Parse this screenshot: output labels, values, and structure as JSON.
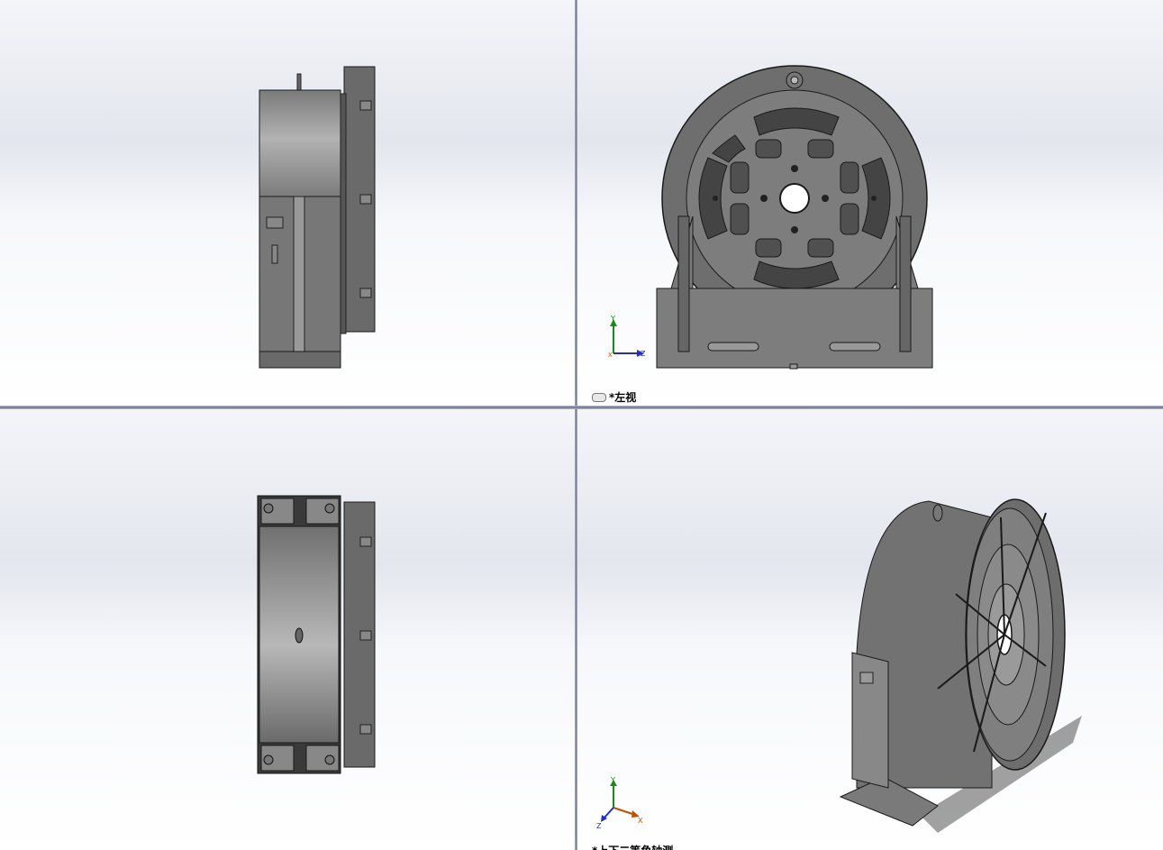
{
  "viewports": {
    "top_right": {
      "label": "*左视"
    },
    "bottom_right": {
      "label": "*上下二等角轴测"
    }
  },
  "triad": {
    "x": "X",
    "y": "Y",
    "z": "Z"
  },
  "colors": {
    "part_body": "#8c8c8c",
    "part_dark": "#5a5a5a",
    "part_edge": "#1a1a1a",
    "axis_x": "#c05000",
    "axis_y": "#1a8a1a",
    "axis_z": "#2030c0"
  }
}
